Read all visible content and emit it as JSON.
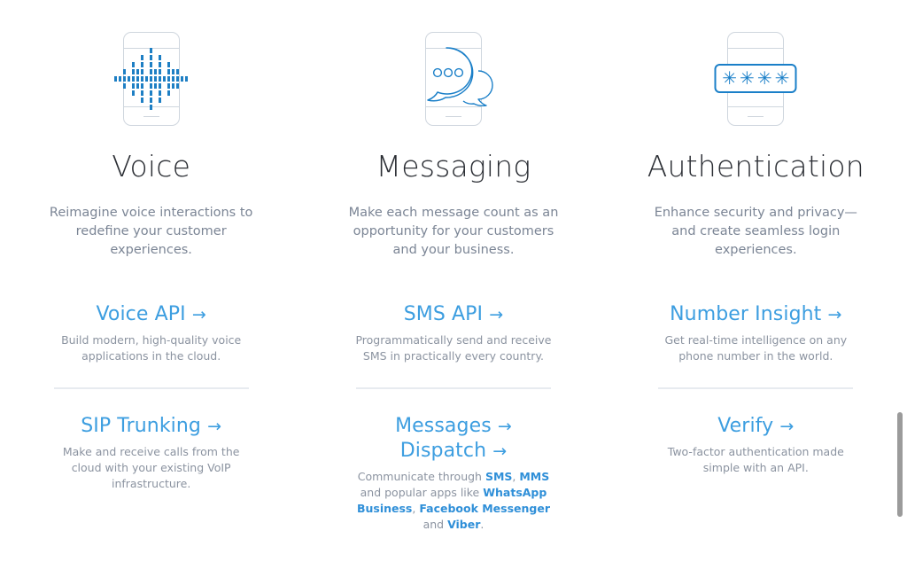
{
  "columns": [
    {
      "icon": "voice-waveform-phone-icon",
      "title": "Voice",
      "description": "Reimagine voice interactions to redefine your customer experiences.",
      "links": [
        {
          "label": "Voice API",
          "arrow": "→",
          "description": "Build modern, high-quality voice applications in the cloud."
        },
        {
          "label": "SIP Trunking",
          "arrow": "→",
          "description": "Make and receive calls from the cloud with your existing VoIP infrastructure."
        }
      ]
    },
    {
      "icon": "messaging-bubbles-phone-icon",
      "title": "Messaging",
      "description": "Make each message count as an opportunity for your customers and your business.",
      "links": [
        {
          "label": "SMS API",
          "arrow": "→",
          "description": "Programmatically send and receive SMS in practically every country."
        },
        {
          "label": "Messages",
          "arrow": "→",
          "label2": "Dispatch",
          "arrow2": "→",
          "description_html": "Communicate through <b>SMS</b>, <b>MMS</b> and popular apps like <b>WhatsApp Business</b>, <b>Facebook Messenger</b> and <b>Viber</b>."
        }
      ]
    },
    {
      "icon": "authentication-passcode-phone-icon",
      "title": "Authentication",
      "description": "Enhance security and privacy—and create seamless login experiences.",
      "links": [
        {
          "label": "Number Insight",
          "arrow": "→",
          "description": "Get real-time intelligence on any phone number in the world."
        },
        {
          "label": "Verify",
          "arrow": "→",
          "description": "Two-factor authentication made simple with an API."
        }
      ]
    }
  ],
  "auth_icon": {
    "masked_characters": "✳✳✳✳",
    "count": 4
  },
  "colors": {
    "link_blue": "#3d9ee0",
    "icon_blue": "#1a7fc8",
    "title_dark": "#2b2e34",
    "body_gray": "#7b8595",
    "divider": "#e7ebf0",
    "phone_outline": "#cfd6de",
    "scrollbar_thumb": "#9b9b9b",
    "background": "#ffffff"
  },
  "waveform": {
    "column_dash_counts": [
      1,
      1,
      3,
      1,
      5,
      3,
      7,
      1,
      9,
      3,
      7,
      1,
      5,
      3,
      3,
      1,
      1
    ]
  }
}
